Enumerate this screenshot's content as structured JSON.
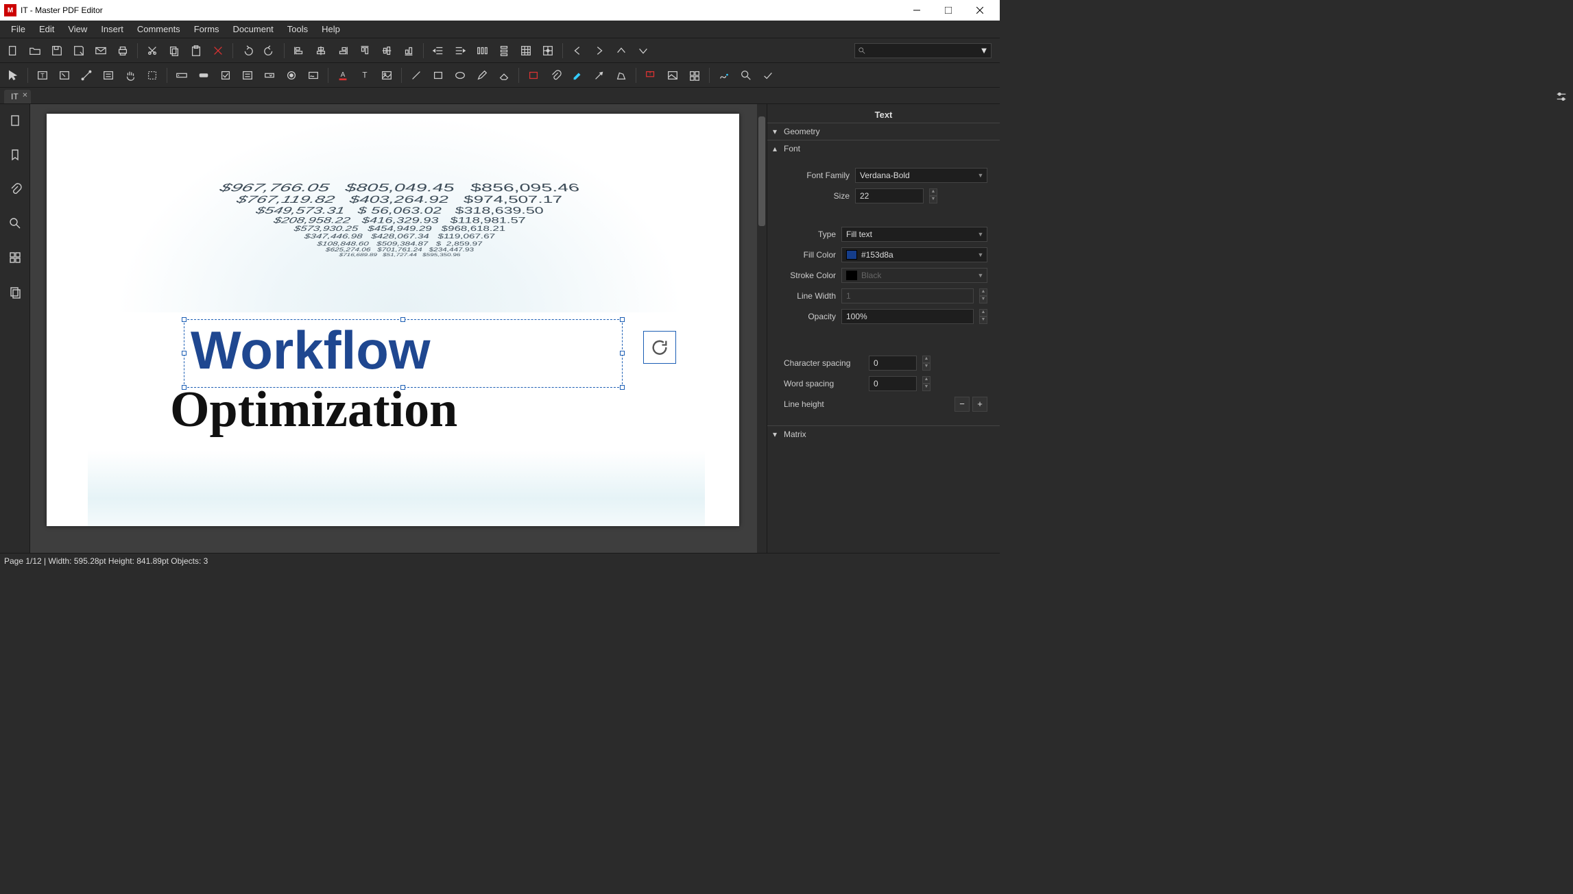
{
  "window": {
    "title": "IT - Master PDF Editor"
  },
  "menu": [
    "File",
    "Edit",
    "View",
    "Insert",
    "Comments",
    "Forms",
    "Document",
    "Tools",
    "Help"
  ],
  "tabs": [
    {
      "label": "IT"
    }
  ],
  "doc": {
    "headline1": "Workflow",
    "headline2": "Optimization",
    "bg_numbers": [
      "$967,766.05   $805,049.45   $856,095.46",
      "$767,119.82   $403,264.92   $974,507.17",
      "$549,573.31   $ 56,063.02   $318,639.50",
      "$208,958.22   $416,329.93   $118,981.57",
      "$573,930.25   $454,949.29   $968,618.21",
      "$347,446.98   $428,067.34   $119,067.67",
      "$108,848.60   $509,384.87   $  2,859.97",
      "$625,274.06   $701,761.24   $234,447.93",
      "$716,689.89   $51,727.44   $595,350.96"
    ]
  },
  "panel": {
    "title": "Text",
    "sections": {
      "geometry": "Geometry",
      "font": "Font",
      "matrix": "Matrix"
    },
    "font": {
      "family_label": "Font Family",
      "family_value": "Verdana-Bold",
      "size_label": "Size",
      "size_value": "22",
      "type_label": "Type",
      "type_value": "Fill text",
      "fill_label": "Fill Color",
      "fill_value": "#153d8a",
      "stroke_label": "Stroke Color",
      "stroke_value": "Black",
      "linewidth_label": "Line Width",
      "linewidth_value": "1",
      "opacity_label": "Opacity",
      "opacity_value": "100%",
      "char_label": "Character spacing",
      "char_value": "0",
      "word_label": "Word spacing",
      "word_value": "0",
      "lineh_label": "Line height"
    }
  },
  "status": "Page 1/12 | Width: 595.28pt Height: 841.89pt Objects: 3"
}
